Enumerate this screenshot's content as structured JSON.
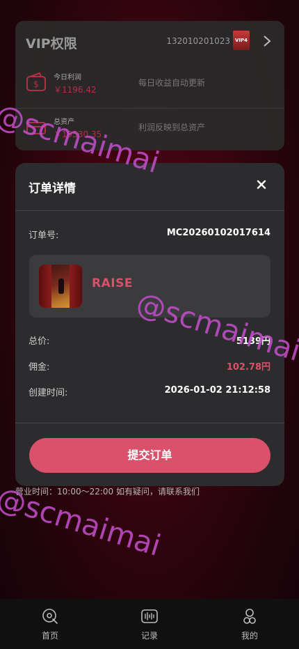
{
  "vip": {
    "title": "VIP权限",
    "account": "132010201023",
    "badge": "VIP4",
    "rows": [
      {
        "label": "今日利润",
        "value": "￥1196.42",
        "note": "每日收益自动更新"
      },
      {
        "label": "总资产",
        "value": "￥19530.35",
        "note": "利润反映到总资产"
      }
    ]
  },
  "modal": {
    "title": "订单详情",
    "close_icon": "close-icon",
    "order_label": "订单号:",
    "order_value": "MC20260102017614",
    "product_name": "RAISE",
    "total_label": "总价:",
    "total_value": "5139円",
    "commission_label": "佣金:",
    "commission_value": "102.78円",
    "created_label": "创建时间:",
    "created_value": "2026-01-02 21:12:58",
    "submit_label": "提交订单"
  },
  "hours_text": "营业时间：10:00～22:00 如有疑问，请联系我们",
  "watermark": "@scmaimai",
  "tabs": [
    {
      "label": "首页",
      "icon": "home-icon"
    },
    {
      "label": "记录",
      "icon": "records-icon"
    },
    {
      "label": "我的",
      "icon": "profile-icon"
    }
  ],
  "colors": {
    "accent": "#d9516a",
    "modal_bg": "#2c2c2e",
    "card_bg": "#3b3b3e",
    "watermark": "#c14dc9"
  }
}
